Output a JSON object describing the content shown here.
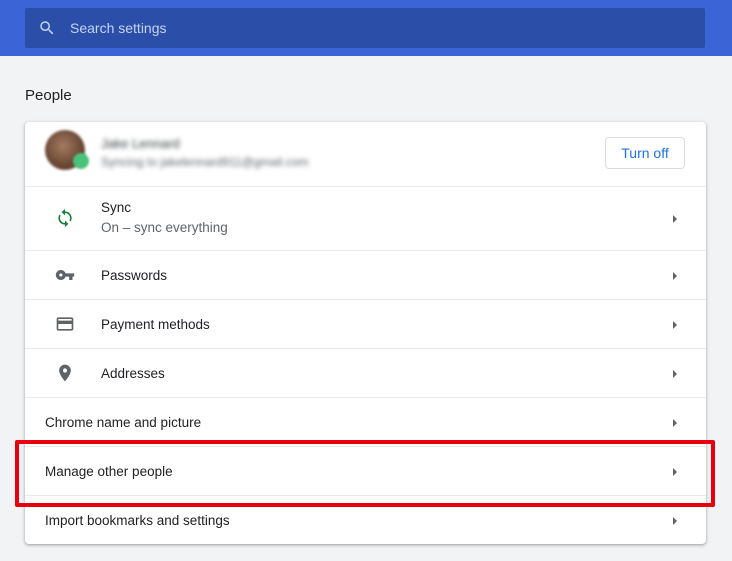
{
  "search": {
    "placeholder": "Search settings",
    "icon": "search-icon"
  },
  "section": {
    "title": "People"
  },
  "account": {
    "name": "Jake Lennard",
    "email": "Syncing to jakelennard911@gmail.com",
    "turn_off_label": "Turn off"
  },
  "rows": [
    {
      "label": "Sync",
      "sublabel": "On – sync everything",
      "icon": "sync-icon"
    },
    {
      "label": "Passwords",
      "icon": "key-icon"
    },
    {
      "label": "Payment methods",
      "icon": "credit-card-icon"
    },
    {
      "label": "Addresses",
      "icon": "location-pin-icon"
    },
    {
      "label": "Chrome name and picture"
    },
    {
      "label": "Manage other people",
      "highlighted": true
    },
    {
      "label": "Import bookmarks and settings"
    }
  ],
  "colors": {
    "header": "#3b65d6",
    "search_bg": "#2b4fa8",
    "accent": "#1a73e8",
    "sync_icon": "#188038",
    "highlight": "#e8000e"
  }
}
